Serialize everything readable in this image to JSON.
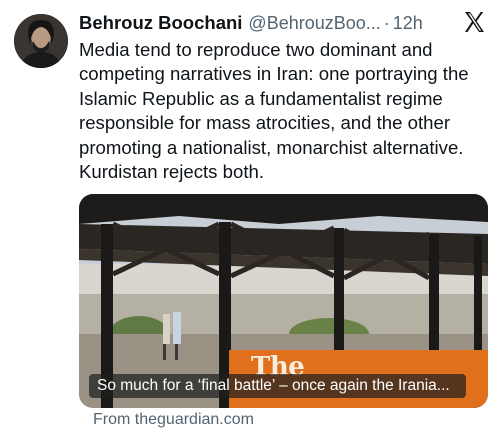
{
  "author": {
    "display_name": "Behrouz Boochani",
    "handle": "@BehrouzBoo...",
    "separator": "·",
    "time": "12h",
    "avatar_icon": "user-photo-avatar"
  },
  "platform_icon": "x-logo-icon",
  "tweet": {
    "text": "Media tend to reproduce two dominant and competing narratives in Iran: one portraying the Islamic Republic as a fundamentalist regime responsible for mass atrocities, and the other promoting a nationalist, monarchist alternative. Kurdistan rejects both."
  },
  "link_card": {
    "image_overlay_title": "The",
    "caption": "So much for a ‘final battle’ – once again the Irania...",
    "source": "From theguardian.com",
    "brand_color": "#e0701c"
  },
  "colors": {
    "text_primary": "#0f1419",
    "text_secondary": "#536471"
  }
}
